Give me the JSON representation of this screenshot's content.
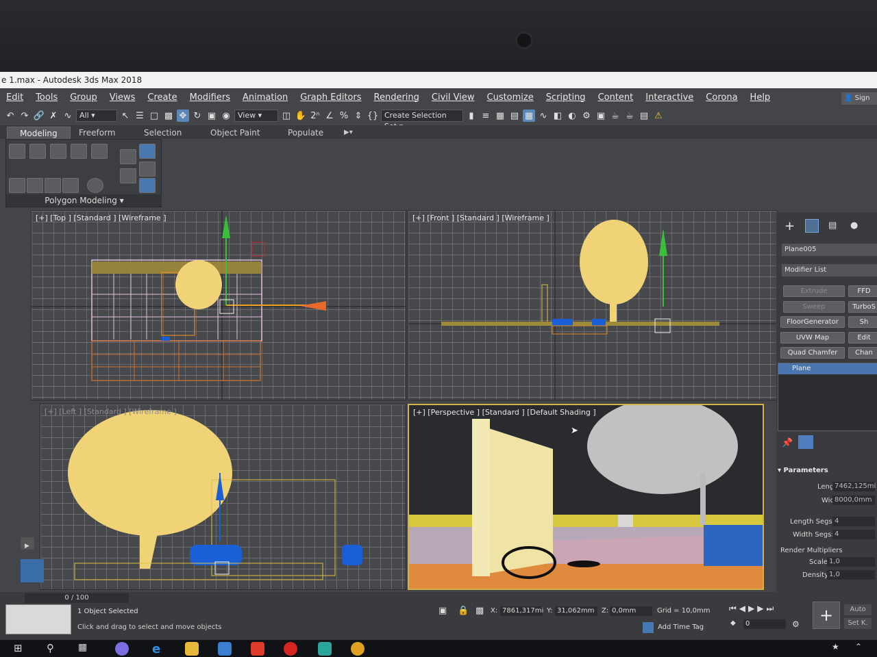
{
  "window": {
    "title": "e 1.max - Autodesk 3ds Max 2018"
  },
  "menu": [
    "Edit",
    "Tools",
    "Group",
    "Views",
    "Create",
    "Modifiers",
    "Animation",
    "Graph Editors",
    "Rendering",
    "Civil View",
    "Customize",
    "Scripting",
    "Content",
    "Interactive",
    "Corona",
    "Help"
  ],
  "sign_in": "Sign In",
  "toolbar": {
    "filter_value": "All",
    "ref_coord_value": "View",
    "selection_set": "Create Selection Set"
  },
  "ribbon": {
    "tabs": [
      "Modeling",
      "Freeform",
      "Selection",
      "Object Paint",
      "Populate"
    ],
    "panel_label": "Polygon Modeling"
  },
  "viewports": {
    "top": "[+] [Top ] [Standard ] [Wireframe ]",
    "front": "[+] [Front ] [Standard ] [Wireframe ]",
    "left": "[+] [Left ] [Standard ] [Wireframe ]",
    "perspective": "[+] [Perspective ] [Standard ] [Default Shading ]"
  },
  "command_panel": {
    "object_name": "Plane005",
    "modifier_list": "Modifier List",
    "buttons": [
      "Extrude",
      "FFD",
      "Sweep",
      "TurboS",
      "FloorGenerator",
      "Sh",
      "UVW Map",
      "Edit",
      "Quad Chamfer",
      "Chan"
    ],
    "stack_item": "Plane",
    "rollout": "Parameters",
    "length_label": "Length:",
    "length_value": "7462,125mi",
    "width_label": "Width:",
    "width_value": "8000,0mm",
    "length_segs_label": "Length Segs:",
    "length_segs_value": "4",
    "width_segs_label": "Width Segs:",
    "width_segs_value": "4",
    "render_mult": "Render Multipliers",
    "scale_label": "Scale:",
    "scale_value": "1,0",
    "density_label": "Density:",
    "density_value": "1,0"
  },
  "timeline": {
    "frame": "0 / 100"
  },
  "status": {
    "selected": "1 Object Selected",
    "prompt": "Click and drag to select and move objects",
    "x_label": "X:",
    "x_value": "7861,317mi",
    "y_label": "Y:",
    "y_value": "31,062mm",
    "z_label": "Z:",
    "z_value": "0,0mm",
    "grid": "Grid = 10,0mm",
    "add_time_tag": "Add Time Tag",
    "frame_field": "0",
    "auto": "Auto",
    "set_key": "Set K."
  },
  "colors": {
    "tree": "#f0d277",
    "selection_blue": "#1a5fd6",
    "accent": "#5b86b8",
    "active_viewport": "#d2b34a"
  }
}
